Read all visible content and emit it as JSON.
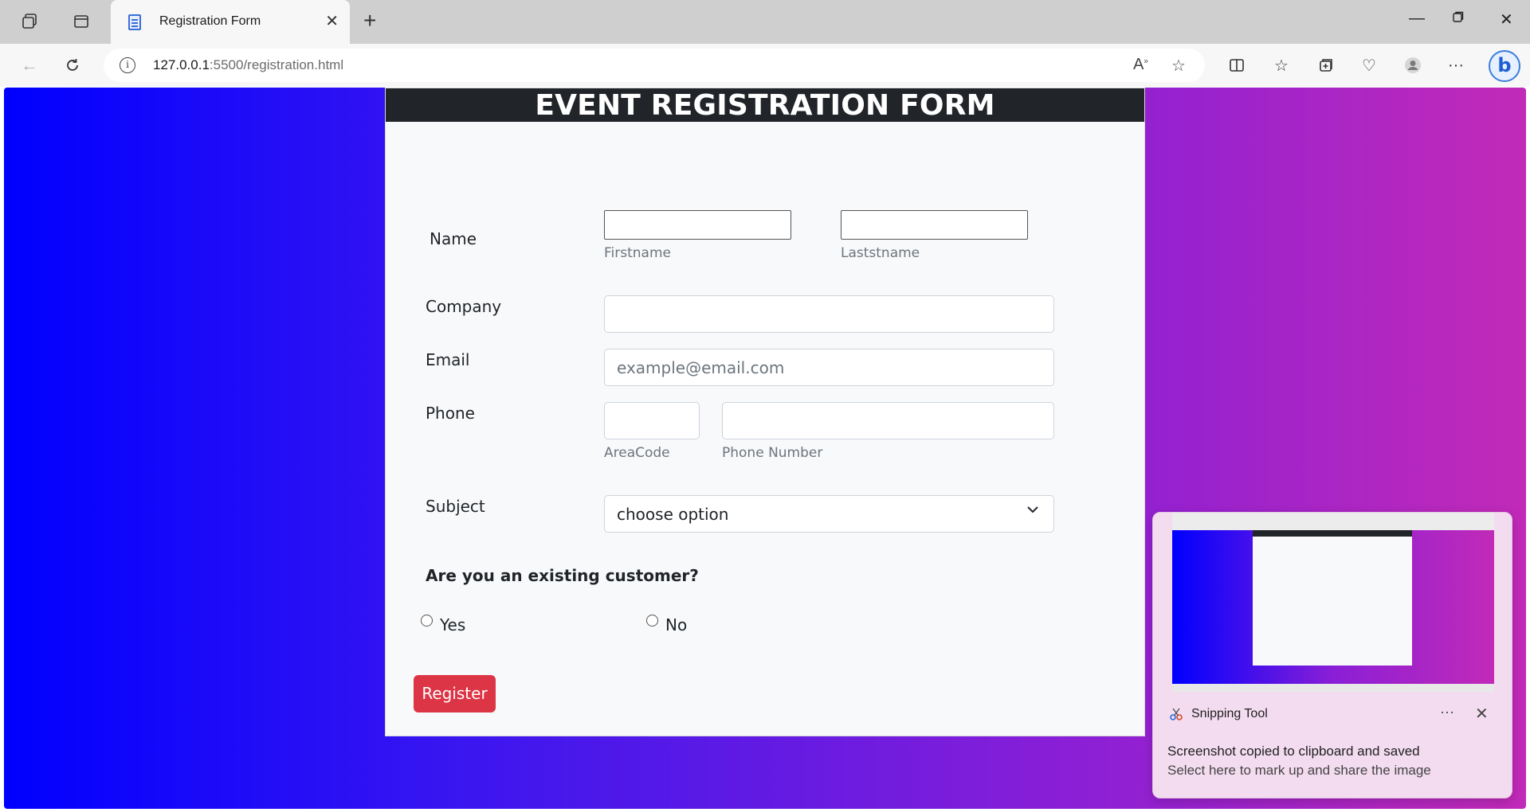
{
  "browser": {
    "tab_title": "Registration Form",
    "url_host": "127.0.0.1",
    "url_path": ":5500/registration.html"
  },
  "form": {
    "header": "EVENT REGISTRATION FORM",
    "name_label": "Name",
    "firstname_hint": "Firstname",
    "lastname_hint": "Laststname",
    "company_label": "Company",
    "email_label": "Email",
    "email_placeholder": "example@email.com",
    "phone_label": "Phone",
    "areacode_hint": "AreaCode",
    "phonenumber_hint": "Phone Number",
    "subject_label": "Subject",
    "subject_selected": "choose option",
    "question": "Are you an existing customer?",
    "radio_yes": "Yes",
    "radio_no": "No",
    "register_button": "Register"
  },
  "toast": {
    "app_name": "Snipping Tool",
    "title": "Screenshot copied to clipboard and saved",
    "subtitle": "Select here to mark up and share the image"
  },
  "colors": {
    "gradient_start": "#0000ff",
    "gradient_end": "#c22ab8",
    "header_bg": "#212529",
    "register_bg": "#dc3545"
  }
}
